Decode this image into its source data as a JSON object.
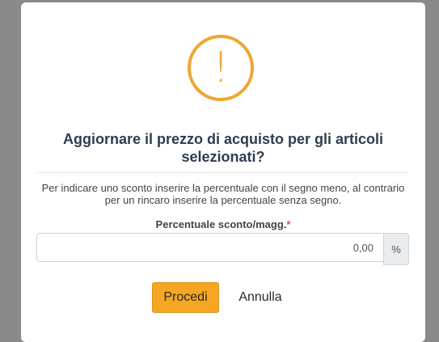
{
  "dialog": {
    "icon": "exclamation-icon",
    "icon_glyph": "!",
    "title": "Aggiornare il prezzo di acquisto per gli articoli selezionati?",
    "description": "Per indicare uno sconto inserire la percentuale con il segno meno, al contrario per un rincaro inserire la percentuale senza segno.",
    "field": {
      "label": "Percentuale sconto/magg.",
      "required_mark": "*",
      "value": "0,00",
      "unit": "%"
    },
    "buttons": {
      "confirm": "Procedi",
      "cancel": "Annulla"
    }
  },
  "colors": {
    "accent": "#f5a623",
    "warning": "#f0a532",
    "title": "#2e3d50",
    "required": "#d9534f"
  }
}
